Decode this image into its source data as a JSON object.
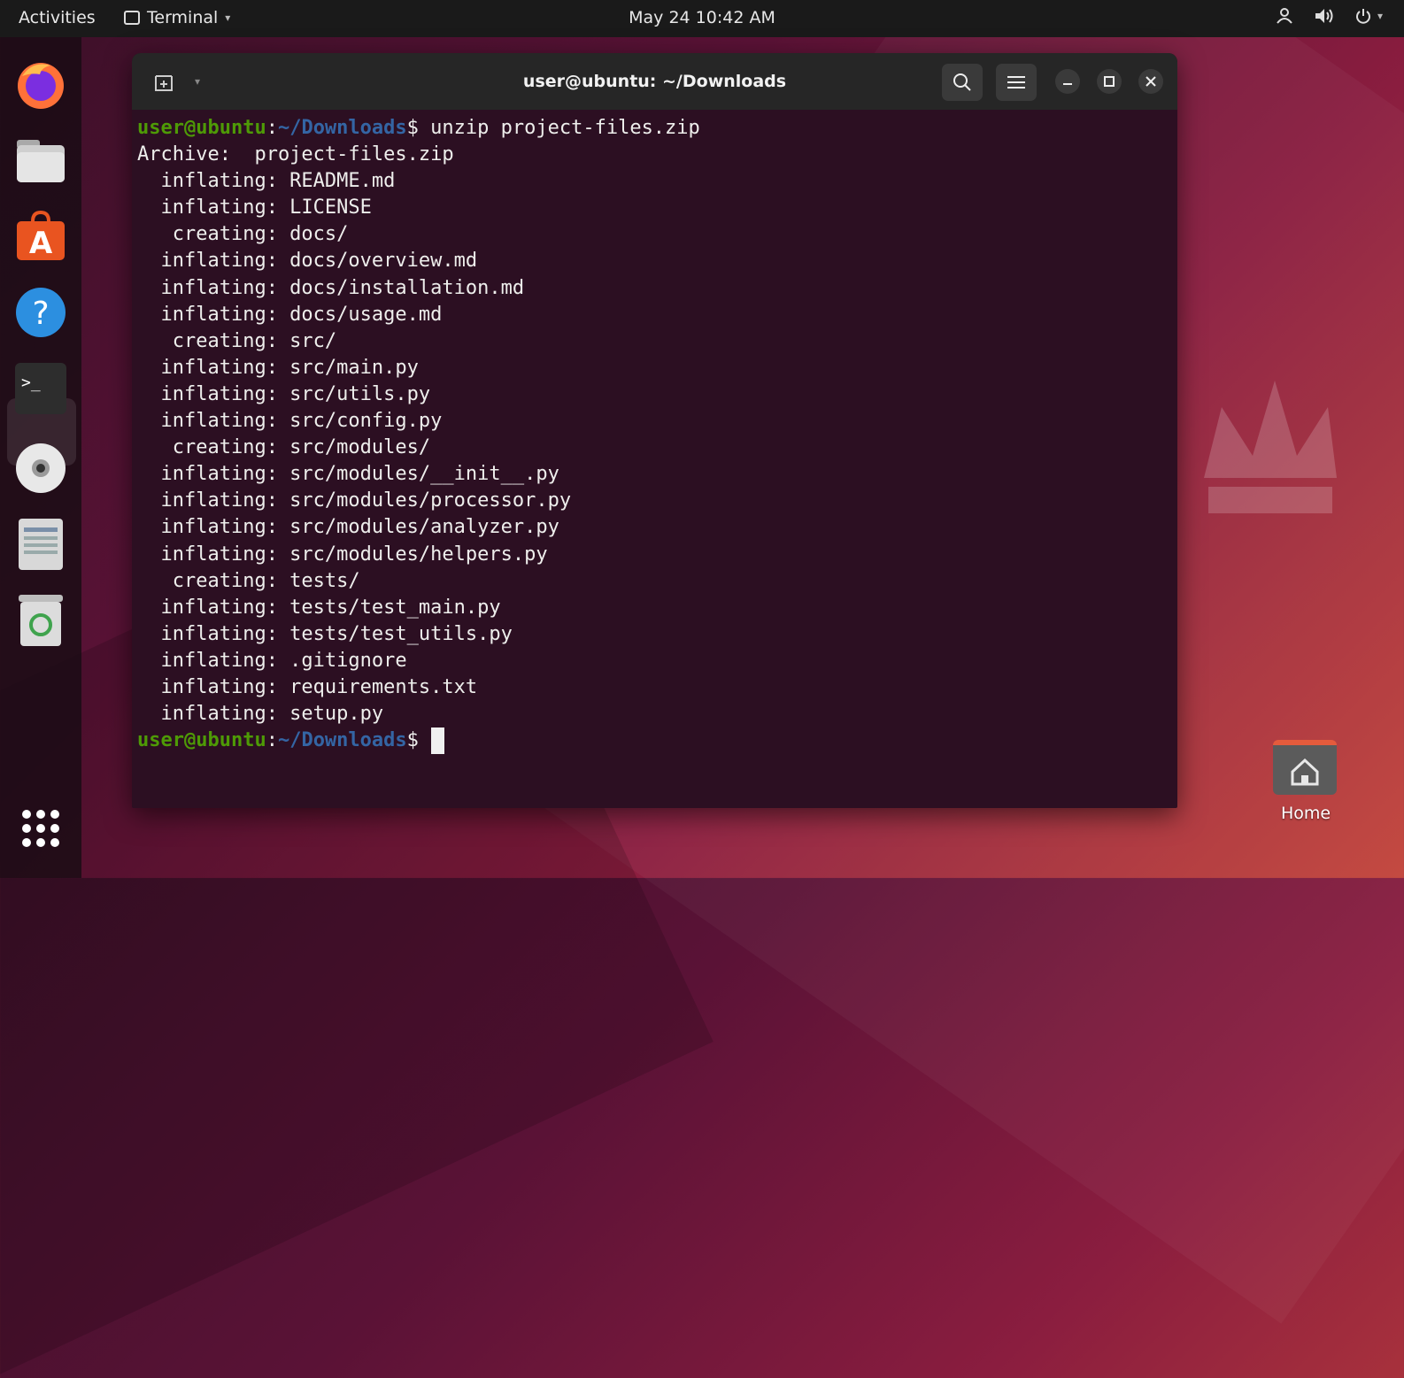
{
  "topbar": {
    "activities": "Activities",
    "app_name": "Terminal",
    "clock": "May 24  10:42 AM",
    "tray_icons": [
      "network-icon",
      "volume-icon",
      "power-icon"
    ]
  },
  "dock": {
    "items": [
      "firefox-icon",
      "files-icon",
      "app-center-icon",
      "help-icon",
      "terminal-icon",
      "disc-icon",
      "text-editor-icon",
      "trash-icon"
    ],
    "active": "terminal-icon",
    "app_grid": "show-apps-icon"
  },
  "desktop": {
    "home_label": "Home"
  },
  "terminal": {
    "title": "user@ubuntu: ~/Downloads",
    "prompt_user": "user@ubuntu",
    "prompt_sep": ":",
    "prompt_path": "~/Downloads",
    "prompt_dollar": "$",
    "command": " unzip project-files.zip",
    "output_lines": [
      "Archive:  project-files.zip",
      "  inflating: README.md",
      "  inflating: LICENSE",
      "   creating: docs/",
      "  inflating: docs/overview.md",
      "  inflating: docs/installation.md",
      "  inflating: docs/usage.md",
      "   creating: src/",
      "  inflating: src/main.py",
      "  inflating: src/utils.py",
      "  inflating: src/config.py",
      "   creating: src/modules/",
      "  inflating: src/modules/__init__.py",
      "  inflating: src/modules/processor.py",
      "  inflating: src/modules/analyzer.py",
      "  inflating: src/modules/helpers.py",
      "   creating: tests/",
      "  inflating: tests/test_main.py",
      "  inflating: tests/test_utils.py",
      "  inflating: .gitignore",
      "  inflating: requirements.txt",
      "  inflating: setup.py"
    ]
  },
  "colors": {
    "prompt_user": "#4e9a06",
    "prompt_path": "#3465a4",
    "terminal_bg": "#2c0f22"
  }
}
